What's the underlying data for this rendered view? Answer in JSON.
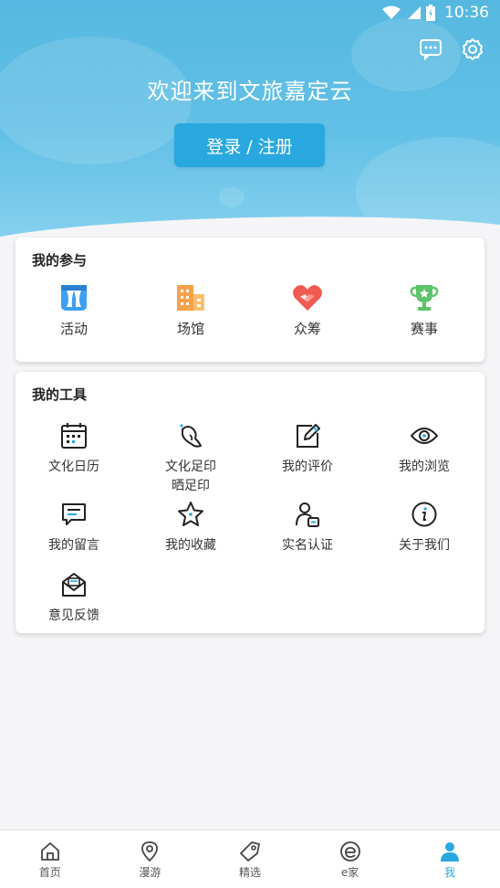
{
  "status_bar": {
    "time": "10:36"
  },
  "header": {
    "welcome_text": "欢迎来到文旅嘉定云",
    "login_label": "登录 / 注册"
  },
  "participation": {
    "title": "我的参与",
    "items": [
      {
        "label": "活动",
        "icon": "activity-icon",
        "color": "#3d9ff0"
      },
      {
        "label": "场馆",
        "icon": "venue-icon",
        "color": "#f7a24a"
      },
      {
        "label": "众筹",
        "icon": "crowdfunding-icon",
        "color": "#f05a50"
      },
      {
        "label": "赛事",
        "icon": "trophy-icon",
        "color": "#5cc46a"
      }
    ]
  },
  "tools": {
    "title": "我的工具",
    "items": [
      {
        "label": "文化日历",
        "icon": "calendar-icon"
      },
      {
        "label": "文化足印\n晒足印",
        "icon": "footprint-icon"
      },
      {
        "label": "我的评价",
        "icon": "review-icon"
      },
      {
        "label": "我的浏览",
        "icon": "eye-icon"
      },
      {
        "label": "我的留言",
        "icon": "message-icon"
      },
      {
        "label": "我的收藏",
        "icon": "star-icon"
      },
      {
        "label": "实名认证",
        "icon": "verify-icon"
      },
      {
        "label": "关于我们",
        "icon": "info-icon"
      },
      {
        "label": "意见反馈",
        "icon": "feedback-icon"
      }
    ]
  },
  "bottom_nav": {
    "items": [
      {
        "label": "首页",
        "icon": "home-icon"
      },
      {
        "label": "漫游",
        "icon": "location-icon"
      },
      {
        "label": "精选",
        "icon": "tag-icon"
      },
      {
        "label": "e家",
        "icon": "e-home-icon"
      },
      {
        "label": "我",
        "icon": "person-icon"
      }
    ],
    "active_index": 4,
    "accent_color": "#29a8e0"
  }
}
